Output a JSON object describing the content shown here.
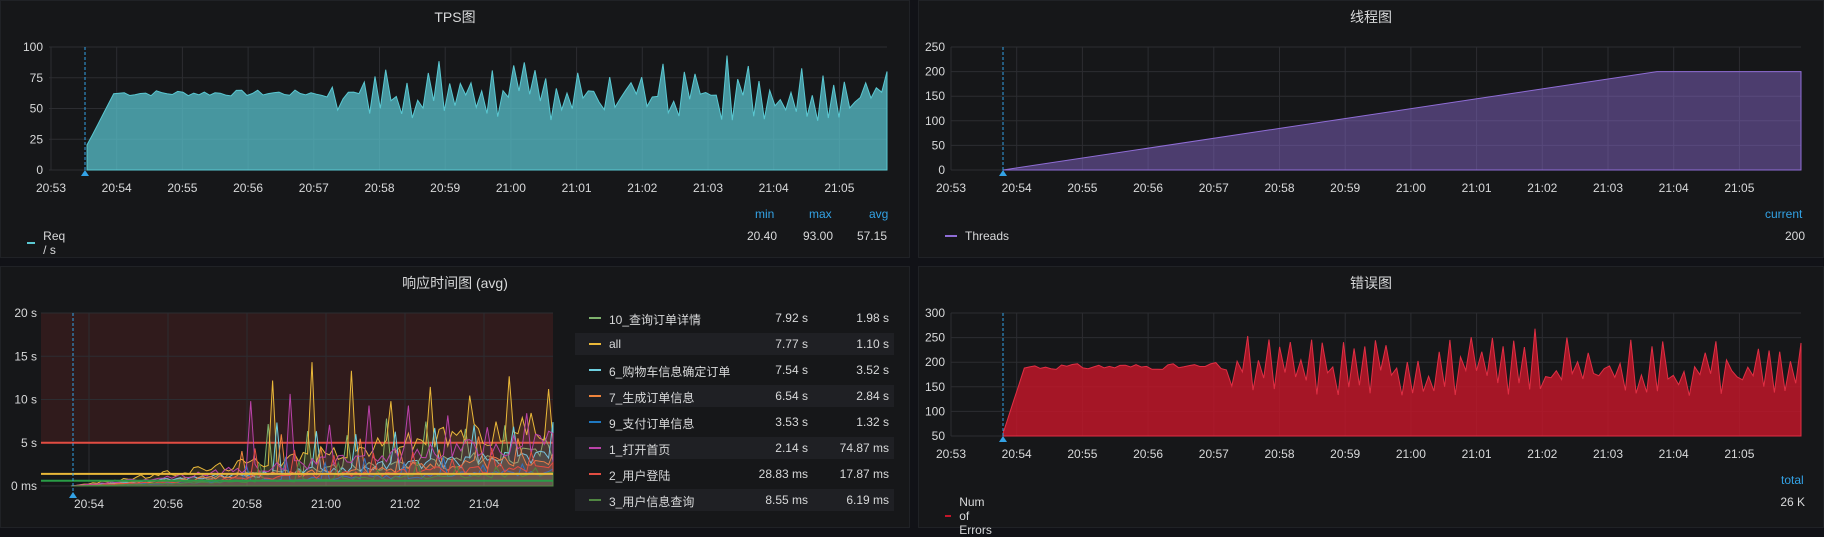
{
  "tps": {
    "title": "TPS图",
    "yticks": [
      "100",
      "75",
      "50",
      "25",
      "0"
    ],
    "xticks": [
      "20:53",
      "20:54",
      "20:55",
      "20:56",
      "20:57",
      "20:58",
      "20:59",
      "21:00",
      "21:01",
      "21:02",
      "21:03",
      "21:04",
      "21:05"
    ],
    "legend": {
      "headers": [
        "min",
        "max",
        "avg"
      ],
      "name": "Req / s",
      "min": "20.40",
      "max": "93.00",
      "avg": "57.15",
      "color": "#5ac8d2"
    }
  },
  "threads": {
    "title": "线程图",
    "yticks": [
      "250",
      "200",
      "150",
      "100",
      "50",
      "0"
    ],
    "xticks": [
      "20:53",
      "20:54",
      "20:55",
      "20:56",
      "20:57",
      "20:58",
      "20:59",
      "21:00",
      "21:01",
      "21:02",
      "21:03",
      "21:04",
      "21:05"
    ],
    "legend": {
      "header": "current",
      "name": "Threads",
      "value": "200",
      "color": "#8f6dd6"
    }
  },
  "rt": {
    "title": "响应时间图 (avg)",
    "yticks": [
      "20 s",
      "15 s",
      "10 s",
      "5 s",
      "0 ms"
    ],
    "xticks": [
      "20:54",
      "20:56",
      "20:58",
      "21:00",
      "21:02",
      "21:04"
    ],
    "rows": [
      {
        "name": "10_查询订单详情",
        "v1": "7.92 s",
        "v2": "1.98 s",
        "color": "#7eb26d"
      },
      {
        "name": "all",
        "v1": "7.77 s",
        "v2": "1.10 s",
        "color": "#eab839"
      },
      {
        "name": "6_购物车信息确定订单",
        "v1": "7.54 s",
        "v2": "3.52 s",
        "color": "#6ed0e0"
      },
      {
        "name": "7_生成订单信息",
        "v1": "6.54 s",
        "v2": "2.84 s",
        "color": "#ef843c"
      },
      {
        "name": "9_支付订单信息",
        "v1": "3.53 s",
        "v2": "1.32 s",
        "color": "#1f78c1"
      },
      {
        "name": "1_打开首页",
        "v1": "2.14 s",
        "v2": "74.87 ms",
        "color": "#ba43a9"
      },
      {
        "name": "2_用户登陆",
        "v1": "28.83 ms",
        "v2": "17.87 ms",
        "color": "#e24d42"
      },
      {
        "name": "3_用户信息查询",
        "v1": "8.55 ms",
        "v2": "6.19 ms",
        "color": "#508642"
      }
    ]
  },
  "errors": {
    "title": "错误图",
    "yticks": [
      "300",
      "250",
      "200",
      "150",
      "100",
      "50"
    ],
    "xticks": [
      "20:53",
      "20:54",
      "20:55",
      "20:56",
      "20:57",
      "20:58",
      "20:59",
      "21:00",
      "21:01",
      "21:02",
      "21:03",
      "21:04",
      "21:05"
    ],
    "legend": {
      "header": "total",
      "name": "Num of Errors",
      "value": "26 K",
      "color": "#c4162a"
    }
  },
  "chart_data": [
    {
      "type": "area",
      "title": "TPS图",
      "series": [
        {
          "name": "Req / s",
          "min": 20.4,
          "max": 93.0,
          "avg": 57.15
        }
      ],
      "ylim": [
        0,
        100
      ]
    },
    {
      "type": "area",
      "title": "线程图",
      "series": [
        {
          "name": "Threads",
          "values": [
            0,
            200
          ]
        }
      ],
      "ylim": [
        0,
        250
      ]
    },
    {
      "type": "line",
      "title": "响应时间图 (avg)",
      "ylim": [
        0,
        20
      ]
    },
    {
      "type": "area",
      "title": "错误图",
      "series": [
        {
          "name": "Num of Errors",
          "total": "26 K"
        }
      ],
      "ylim": [
        50,
        300
      ]
    }
  ]
}
